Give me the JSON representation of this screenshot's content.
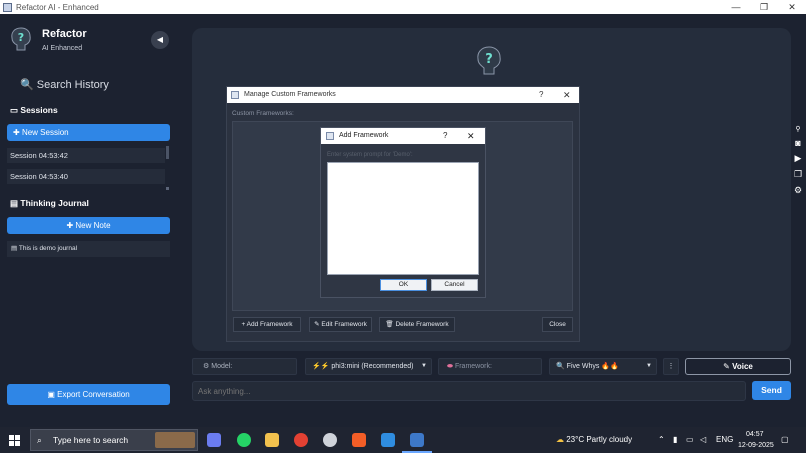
{
  "window": {
    "title": "Refactor AI - Enhanced",
    "minimize": "—",
    "maximize": "❐",
    "close": "✕"
  },
  "sidebar": {
    "brand": "Refactor",
    "brand_sub": "AI Enhanced",
    "collapse": "◀",
    "search_history": "Search History",
    "sessions_title": "Sessions",
    "new_session": "New Session",
    "sessions": [
      "Session 04:53:42",
      "Session 04:53:40"
    ],
    "journal_title": "Thinking Journal",
    "new_note": "New Note",
    "journal_items": [
      "This is demo journal"
    ],
    "export": "Export Conversation"
  },
  "manage_dialog": {
    "title": "Manage Custom Frameworks",
    "help": "?",
    "close": "✕",
    "label": "Custom Frameworks:",
    "add": "+ Add Framework",
    "edit": "Edit Framework",
    "delete": "Delete Framework",
    "close_btn": "Close"
  },
  "add_dialog": {
    "title": "Add Framework",
    "help": "?",
    "close": "✕",
    "prompt_label": "Enter system prompt for 'Demo':",
    "prompt_value": "",
    "ok": "OK",
    "cancel": "Cancel"
  },
  "controls": {
    "model_label": "Model:",
    "model_value": "phi3:mini (Recommended)",
    "framework_label": "Framework:",
    "framework_value": "Five Whys",
    "more": "⋮",
    "voice": "Voice",
    "ask_placeholder": "Ask anything...",
    "send": "Send"
  },
  "taskbar": {
    "search_placeholder": "Type here to search",
    "weather": "23°C  Partly cloudy",
    "lang": "ENG",
    "time": "04:57",
    "date": "12-09-2025"
  },
  "colors": {
    "accent": "#2f86e6",
    "bg": "#1c2230",
    "panel": "#252d3c"
  }
}
